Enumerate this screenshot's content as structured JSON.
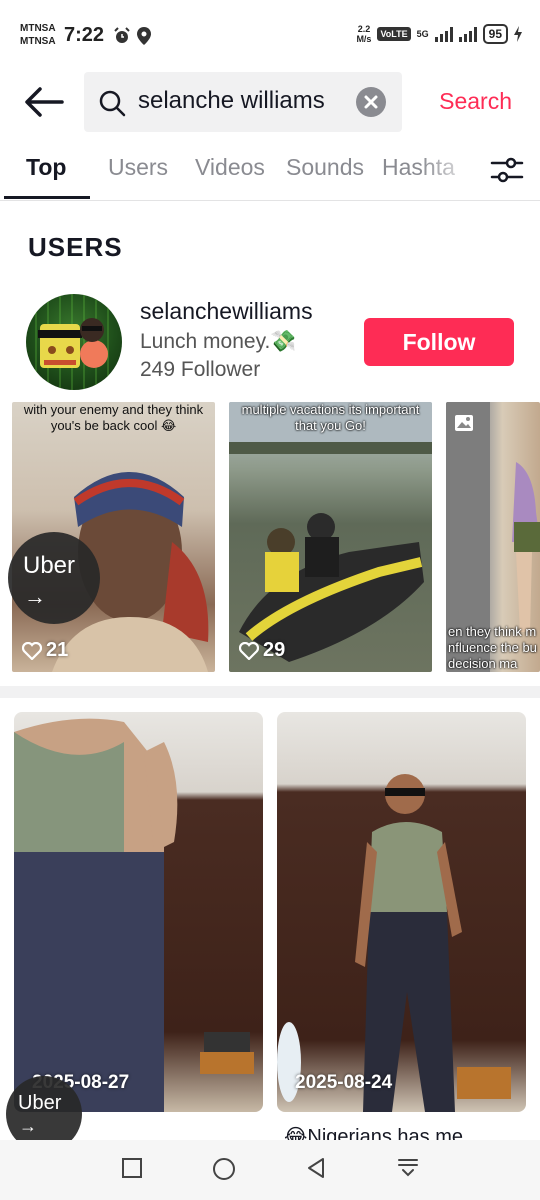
{
  "status_bar": {
    "carrier_1": "MTNSA",
    "carrier_2": "MTNSA",
    "time": "7:22",
    "net_speed": "2.2",
    "net_unit": "M/s",
    "volte": "VoLTE",
    "network": "5G",
    "battery": "95"
  },
  "search": {
    "query": "selanche williams",
    "action_label": "Search"
  },
  "tabs": [
    {
      "label": "Top",
      "active": true
    },
    {
      "label": "Users",
      "active": false
    },
    {
      "label": "Videos",
      "active": false
    },
    {
      "label": "Sounds",
      "active": false
    },
    {
      "label": "Hashta",
      "active": false
    }
  ],
  "users_section": {
    "title": "USERS",
    "user": {
      "username": "selanchewilliams",
      "bio": "Lunch money.💸",
      "followers": "249 Follower",
      "follow_label": "Follow"
    }
  },
  "video_strip": [
    {
      "caption": "with your enemy and they think you's be back cool 😂",
      "likes": "21"
    },
    {
      "caption": "multiple vacations its important that you Go!",
      "likes": "29"
    },
    {
      "caption": "en they think m nfluence the bu decision ma",
      "likes": ""
    }
  ],
  "uber_badge": {
    "label": "Uber",
    "arrow": "→"
  },
  "video_grid": [
    {
      "date": "2025-08-27",
      "caption": ""
    },
    {
      "date": "2025-08-24",
      "caption": "😂Nigerians has me"
    }
  ],
  "colors": {
    "accent": "#fe2c55",
    "text_primary": "#161823",
    "text_secondary": "#8a8b91"
  }
}
